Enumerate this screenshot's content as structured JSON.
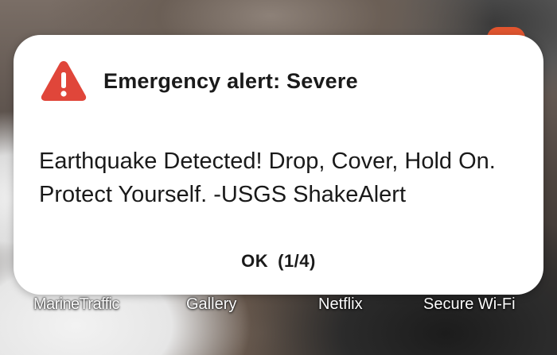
{
  "alert": {
    "title": "Emergency alert: Severe",
    "message": "Earthquake Detected! Drop, Cover, Hold On. Protect Yourself. -USGS ShakeAlert",
    "ok_label": "OK",
    "counter": "(1/4)",
    "icon": "warning-triangle-icon",
    "icon_color": "#e0463a"
  },
  "dock": {
    "apps": [
      {
        "label": "MarineTraffic"
      },
      {
        "label": "Gallery"
      },
      {
        "label": "Netflix"
      },
      {
        "label": "Secure Wi-Fi"
      }
    ]
  }
}
